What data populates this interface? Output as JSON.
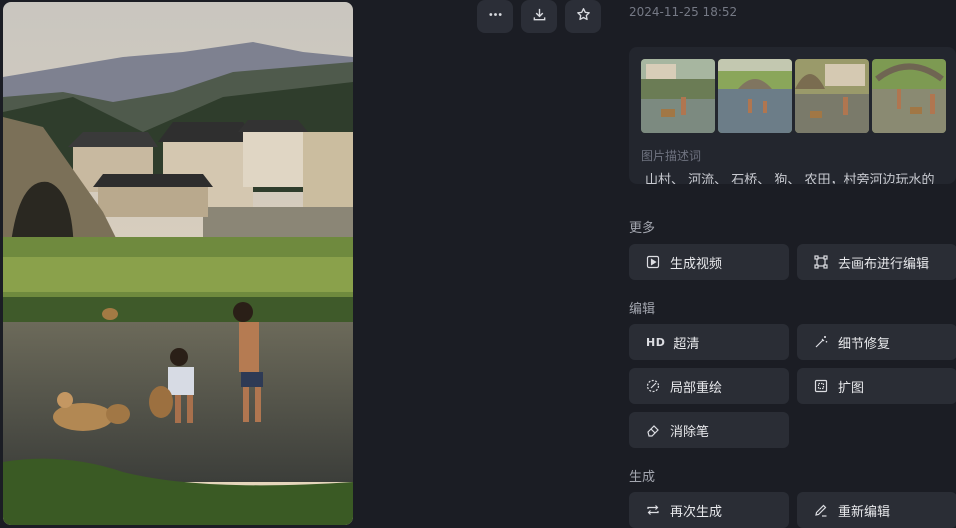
{
  "timestamp": "2024-11-25 18:52",
  "top_actions": {
    "more": "more-icon",
    "download": "download-icon",
    "favorite": "star-icon"
  },
  "reference": {
    "description_label": "图片描述词",
    "description_text": "山村、 河流、 石桥、 狗、 农田，村旁河边玩水的"
  },
  "sections": {
    "more": {
      "title": "更多",
      "buttons": [
        "生成视频",
        "去画布进行编辑"
      ]
    },
    "edit": {
      "title": "编辑",
      "hd_badge": "HD",
      "buttons": [
        "超清",
        "细节修复",
        "局部重绘",
        "扩图",
        "消除笔"
      ]
    },
    "generate": {
      "title": "生成",
      "buttons": [
        "再次生成",
        "重新编辑"
      ]
    }
  },
  "colors": {
    "background": "#1b1d24",
    "button": "#2a2d35",
    "card": "#23262e"
  }
}
